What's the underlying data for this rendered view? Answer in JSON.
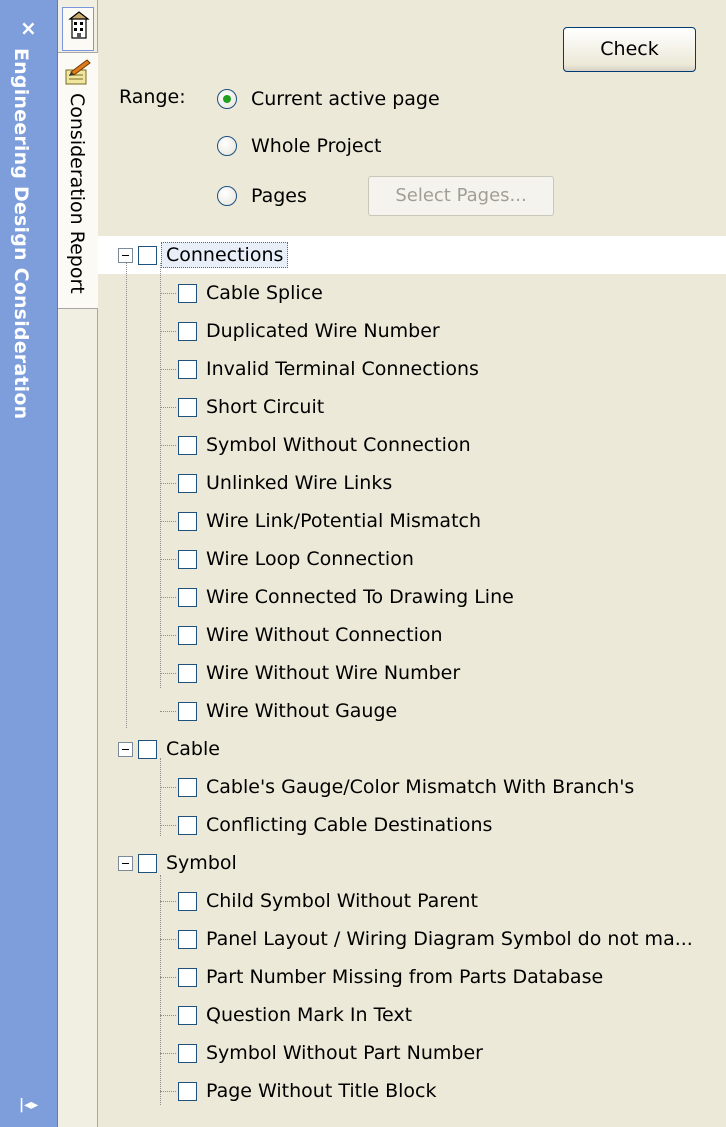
{
  "side_panel": {
    "close_glyph": "×",
    "title": "Engineering Design Consideration",
    "bottom_glyph": "|◂▸"
  },
  "tabs": {
    "top_icon": "building-icon",
    "active_tab": {
      "label": "Consideration Report",
      "icon": "report-pencil-icon"
    }
  },
  "toolbar": {
    "check_label": "Check"
  },
  "range": {
    "label": "Range:",
    "options": [
      {
        "label": "Current active page",
        "checked": true
      },
      {
        "label": "Whole Project",
        "checked": false
      },
      {
        "label": "Pages",
        "checked": false
      }
    ],
    "select_pages_label": "Select Pages..."
  },
  "tree": {
    "groups": [
      {
        "label": "Connections",
        "items": [
          "Cable Splice",
          "Duplicated Wire Number",
          "Invalid Terminal Connections",
          "Short Circuit",
          "Symbol Without Connection",
          "Unlinked Wire Links",
          "Wire Link/Potential Mismatch",
          "Wire Loop Connection",
          "Wire Connected To Drawing Line",
          "Wire Without Connection",
          "Wire Without Wire Number",
          "Wire Without Gauge"
        ]
      },
      {
        "label": "Cable",
        "items": [
          "Cable's Gauge/Color Mismatch With Branch's",
          "Conflicting Cable Destinations"
        ]
      },
      {
        "label": "Symbol",
        "items": [
          "Child Symbol Without Parent",
          "Panel Layout / Wiring Diagram Symbol do not ma...",
          "Part Number Missing from Parts Database",
          "Question Mark In Text",
          "Symbol Without Part Number",
          "Page Without Title Block"
        ]
      }
    ]
  },
  "colors": {
    "side_strip": "#7d9ddb",
    "panel_bg": "#ece9d8",
    "radio_checked": "#21a121"
  }
}
